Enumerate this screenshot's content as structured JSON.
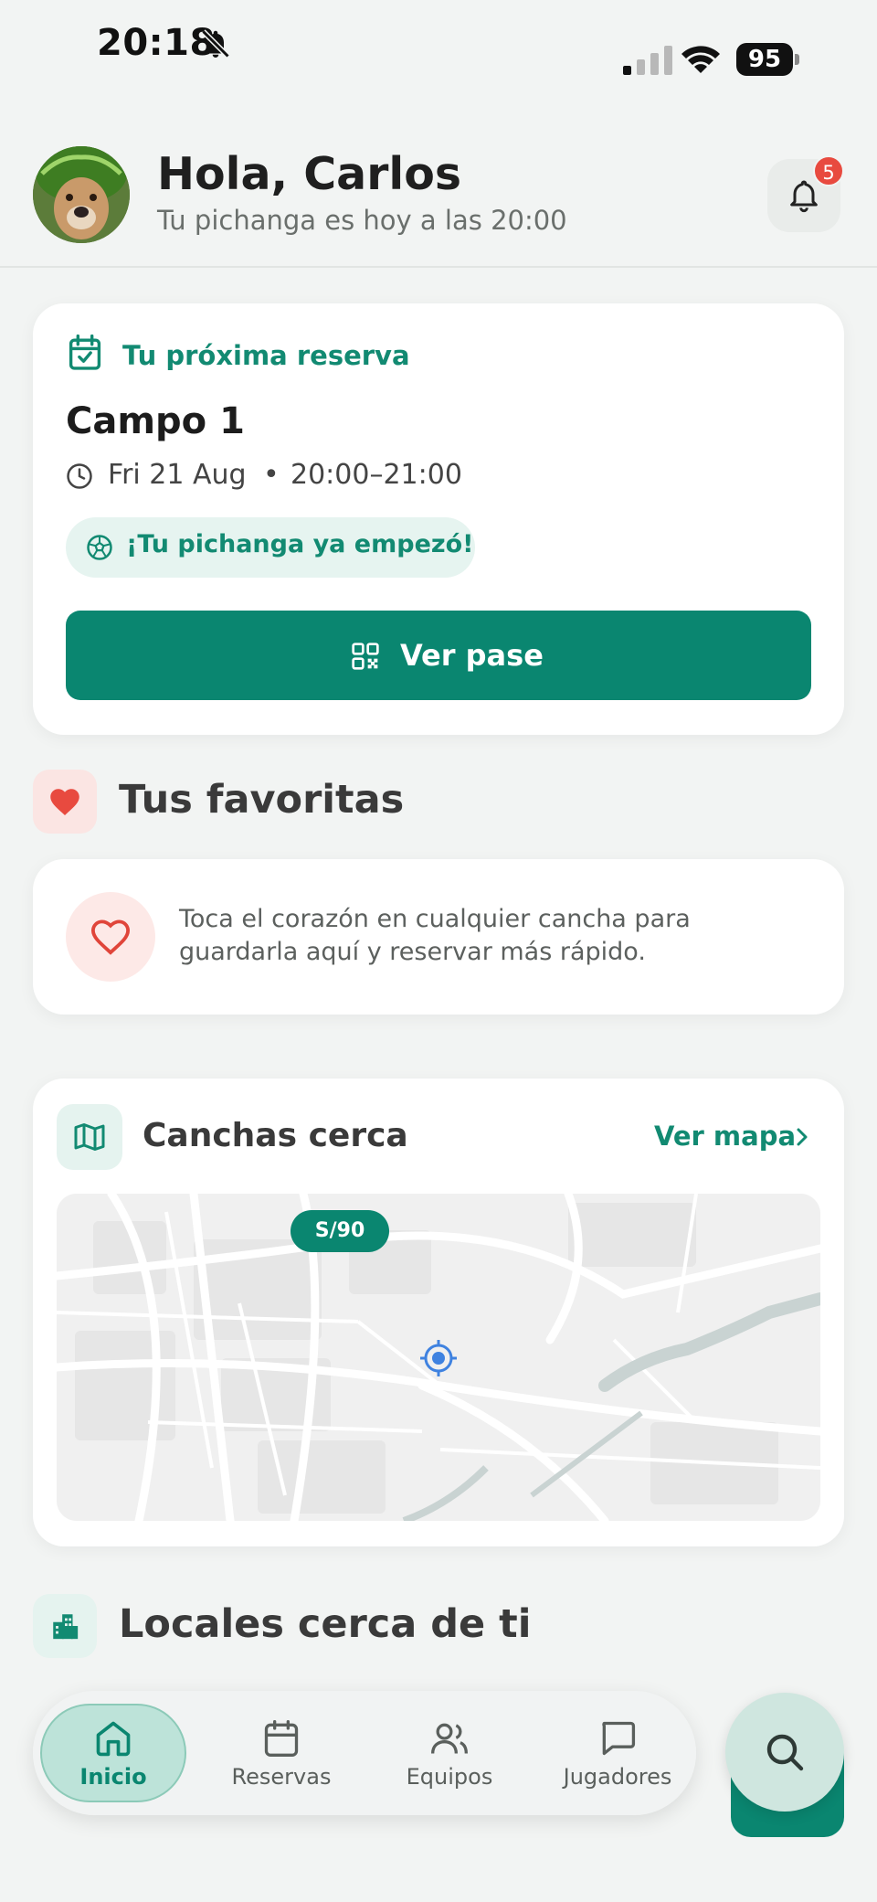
{
  "status_bar": {
    "time": "20:18",
    "battery": "95"
  },
  "header": {
    "greeting": "Hola, Carlos",
    "subtitle": "Tu pichanga es hoy a las 20:00",
    "notification_count": "5"
  },
  "reservation": {
    "label": "Tu próxima reserva",
    "field": "Campo 1",
    "date": "Fri 21 Aug",
    "separator": "•",
    "time": "20:00–21:00",
    "status": "¡Tu pichanga ya empezó!",
    "button_label": "Ver pase"
  },
  "favorites": {
    "title": "Tus favoritas",
    "empty_text": "Toca el corazón en cualquier cancha para guardarla aquí y reservar más rápido."
  },
  "nearby": {
    "title": "Canchas cerca",
    "link_label": "Ver mapa",
    "price_pin": "S/90"
  },
  "venues": {
    "title": "Locales cerca de ti"
  },
  "tabs": [
    {
      "label": "Inicio",
      "icon": "home-icon",
      "active": true
    },
    {
      "label": "Reservas",
      "icon": "calendar-icon",
      "active": false
    },
    {
      "label": "Equipos",
      "icon": "users-icon",
      "active": false
    },
    {
      "label": "Jugadores",
      "icon": "chat-icon",
      "active": false
    }
  ],
  "colors": {
    "accent": "#0a8670",
    "accent_light": "#e6f4f0",
    "badge": "#e84a3f",
    "heart": "#e84a3f"
  }
}
